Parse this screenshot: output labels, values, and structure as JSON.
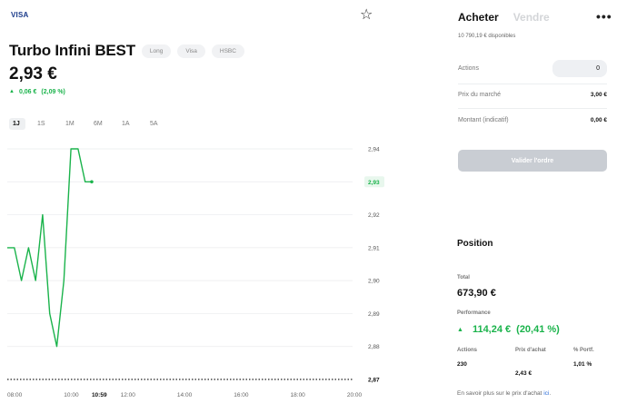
{
  "brand": {
    "logo_text": "VISA",
    "favorite_icon": "star-icon"
  },
  "header": {
    "title": "Turbo Infini BEST",
    "tags": [
      "Long",
      "Visa",
      "HSBC"
    ],
    "price": "2,93 €",
    "change_abs": "0,06 €",
    "change_pct": "(2,09 %)",
    "change_icon": "triangle-up-icon"
  },
  "periods": [
    "1J",
    "1S",
    "1M",
    "6M",
    "1A",
    "5A"
  ],
  "active_period": "1J",
  "chart_data": {
    "type": "line",
    "x": [
      "08:00",
      "08:15",
      "08:30",
      "08:45",
      "09:00",
      "09:15",
      "09:30",
      "09:45",
      "10:00",
      "10:15",
      "10:30",
      "10:45",
      "10:59"
    ],
    "values": [
      2.91,
      2.91,
      2.9,
      2.91,
      2.9,
      2.92,
      2.89,
      2.88,
      2.9,
      2.94,
      2.94,
      2.93,
      2.93
    ],
    "x_ticks": [
      "08:00",
      "10:00",
      "10:59",
      "12:00",
      "14:00",
      "16:00",
      "18:00",
      "20:00"
    ],
    "y_ticks": [
      "2,94",
      "2,93",
      "2,92",
      "2,91",
      "2,90",
      "2,89",
      "2,88",
      "2,87"
    ],
    "current_label": "2,93",
    "ylim": [
      2.87,
      2.94
    ],
    "line_color": "#1ab34b",
    "grid": true
  },
  "order_panel": {
    "tab_buy": "Acheter",
    "tab_sell": "Vendre",
    "more_icon": "more-icon",
    "available": "10 790,19 € disponibles",
    "actions_label": "Actions",
    "actions_value": "0",
    "market_price_label": "Prix du marché",
    "market_price_value": "3,00 €",
    "amount_label": "Montant (indicatif)",
    "amount_value": "0,00 €",
    "validate_label": "Valider l'ordre"
  },
  "position": {
    "title": "Position",
    "total_label": "Total",
    "total_value": "673,90 €",
    "perf_label": "Performance",
    "perf_abs": "114,24 €",
    "perf_pct": "(20,41 %)",
    "col_actions": "Actions",
    "col_price": "Prix d'achat",
    "col_weight": "% Portf.",
    "actions": "230",
    "purchase_price": "2,43 €",
    "weight": "1,01 %",
    "info_text": "En savoir plus sur le prix d'achat",
    "info_link": "ici",
    "info_suffix": "."
  },
  "colors": {
    "accent_green": "#1ab34b",
    "disabled_button": "#c9cdd3"
  }
}
